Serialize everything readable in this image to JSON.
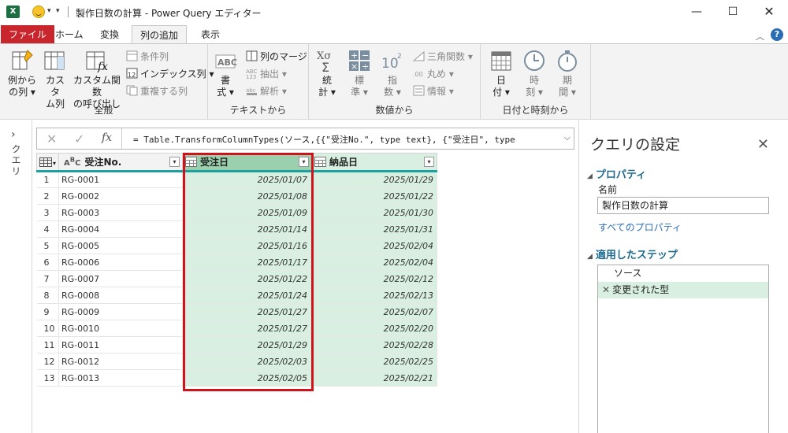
{
  "titlebar": {
    "title": "製作日数の計算 - Power Query エディター",
    "app_letter": "X"
  },
  "tabs": [
    {
      "label": "ファイル"
    },
    {
      "label": "ホーム"
    },
    {
      "label": "変換"
    },
    {
      "label": "列の追加"
    },
    {
      "label": "表示"
    }
  ],
  "ribbon": {
    "general": {
      "label": "全般",
      "example_l1": "例から",
      "example_l2": "の列",
      "custom_l1": "カスタ",
      "custom_l2": "ム列",
      "invoke_l1": "カスタム関数",
      "invoke_l2": "の呼び出し",
      "conditional": "条件列",
      "index": "インデックス列",
      "duplicate": "重複する列"
    },
    "text": {
      "label": "テキストから",
      "format_l1": "書",
      "format_l2": "式",
      "merge": "列のマージ",
      "extract": "抽出",
      "parse": "解析"
    },
    "number": {
      "label": "数値から",
      "stat_l1": "統",
      "stat_l2": "計",
      "std_l1": "標",
      "std_l2": "準",
      "sci_l1": "指",
      "sci_l2": "数",
      "trig": "三角関数",
      "round": "丸め",
      "info": "情報"
    },
    "datetime": {
      "label": "日付と時刻から",
      "date_l1": "日",
      "date_l2": "付",
      "time_l1": "時",
      "time_l2": "刻",
      "dur_l1": "期",
      "dur_l2": "間"
    }
  },
  "left_pane": {
    "label": "クエリ"
  },
  "formula": {
    "text": "= Table.TransformColumnTypes(ソース,{{\"受注No.\", type text}, {\"受注日\", type"
  },
  "table": {
    "columns": [
      "受注No.",
      "受注日",
      "納品日"
    ],
    "rows": [
      [
        "1",
        "RG-0001",
        "2025/01/07",
        "2025/01/29"
      ],
      [
        "2",
        "RG-0002",
        "2025/01/08",
        "2025/01/22"
      ],
      [
        "3",
        "RG-0003",
        "2025/01/09",
        "2025/01/30"
      ],
      [
        "4",
        "RG-0004",
        "2025/01/14",
        "2025/01/31"
      ],
      [
        "5",
        "RG-0005",
        "2025/01/16",
        "2025/02/04"
      ],
      [
        "6",
        "RG-0006",
        "2025/01/17",
        "2025/02/04"
      ],
      [
        "7",
        "RG-0007",
        "2025/01/22",
        "2025/02/12"
      ],
      [
        "8",
        "RG-0008",
        "2025/01/24",
        "2025/02/13"
      ],
      [
        "9",
        "RG-0009",
        "2025/01/27",
        "2025/02/07"
      ],
      [
        "10",
        "RG-0010",
        "2025/01/27",
        "2025/02/20"
      ],
      [
        "11",
        "RG-0011",
        "2025/01/29",
        "2025/02/28"
      ],
      [
        "12",
        "RG-0012",
        "2025/02/03",
        "2025/02/25"
      ],
      [
        "13",
        "RG-0013",
        "2025/02/05",
        "2025/02/21"
      ]
    ],
    "highlight_color": "#d0121b",
    "header_accent": "#1ca19e"
  },
  "right_pane": {
    "title": "クエリの設定",
    "properties_label": "プロパティ",
    "name_label": "名前",
    "name_value": "製作日数の計算",
    "all_properties": "すべてのプロパティ",
    "steps_label": "適用したステップ",
    "steps": [
      "ソース",
      "変更された型"
    ]
  }
}
